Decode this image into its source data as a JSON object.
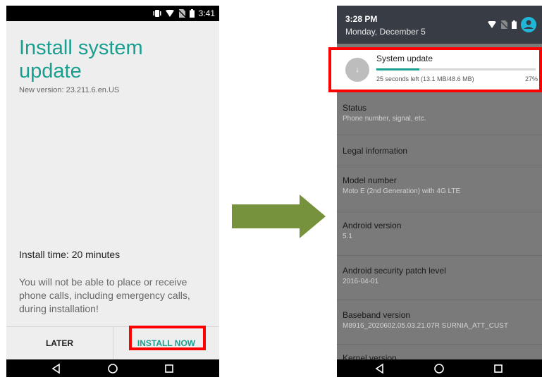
{
  "left": {
    "status_time": "3:41",
    "title": "Install system update",
    "version": "New version: 23.211.6.en.US",
    "install_time": "Install time: 20 minutes",
    "warning": "You will not be able to place or receive phone calls, including emergency calls, during installation!",
    "later_label": "LATER",
    "install_now_label": "INSTALL NOW"
  },
  "right": {
    "time": "3:28 PM",
    "date": "Monday, December 5",
    "notification": {
      "title": "System update",
      "detail": "25 seconds left (13.1 MB/48.6 MB)",
      "percent_label": "27%",
      "progress": 0.27
    },
    "items": [
      {
        "title": "Status",
        "subtitle": "Phone number, signal, etc."
      },
      {
        "title": "Legal information",
        "subtitle": ""
      },
      {
        "title": "Model number",
        "subtitle": "Moto E (2nd Generation) with 4G LTE"
      },
      {
        "title": "Android version",
        "subtitle": "5.1"
      },
      {
        "title": "Android security patch level",
        "subtitle": "2016-04-01"
      },
      {
        "title": "Baseband version",
        "subtitle": "M8916_2020602.05.03.21.07R SURNIA_ATT_CUST"
      },
      {
        "title": "Kernel version",
        "subtitle": ""
      }
    ]
  },
  "colors": {
    "accent": "#1a9e8f",
    "highlight": "#ff0000",
    "arrow": "#76923c"
  },
  "icons": [
    "vibrate-icon",
    "wifi-icon",
    "no-sim-icon",
    "battery-icon",
    "account-icon",
    "back-icon",
    "home-icon",
    "recents-icon",
    "download-icon",
    "right-arrow"
  ]
}
